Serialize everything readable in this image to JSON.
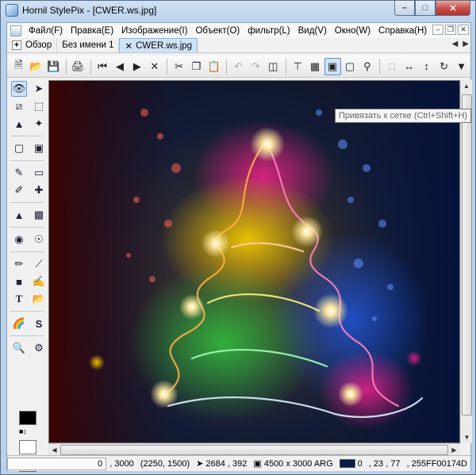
{
  "window": {
    "title": "Hornil StylePix - [CWER.ws.jpg]"
  },
  "menu": [
    "Файл(F)",
    "Правка(E)",
    "Изображение(I)",
    "Объект(O)",
    "фильтр(L)",
    "Вид(V)",
    "Окно(W)",
    "Справка(H)"
  ],
  "tabs": [
    {
      "label": "Обзор",
      "icon": "plus-icon"
    },
    {
      "label": "Без имени 1"
    },
    {
      "label": "CWER.ws.jpg",
      "icon": "close-icon"
    }
  ],
  "tooltip": "Привязать к сетке (Ctrl+Shift+H)",
  "status": {
    "pos_tail": "0",
    "position": ", 3000",
    "pixel": "(2250, 1500)",
    "cursor_coords": "2684 , 392",
    "image_size": "4500 x 3000 ARG",
    "color_value": "0",
    "rgb": ", 23 , 77",
    "hex": ", 255FF00174D"
  },
  "colors": {
    "foreground": "#000000",
    "background": "#ffffff",
    "status_color": "#0a1a4a",
    "accent": "#cfe3f7"
  }
}
